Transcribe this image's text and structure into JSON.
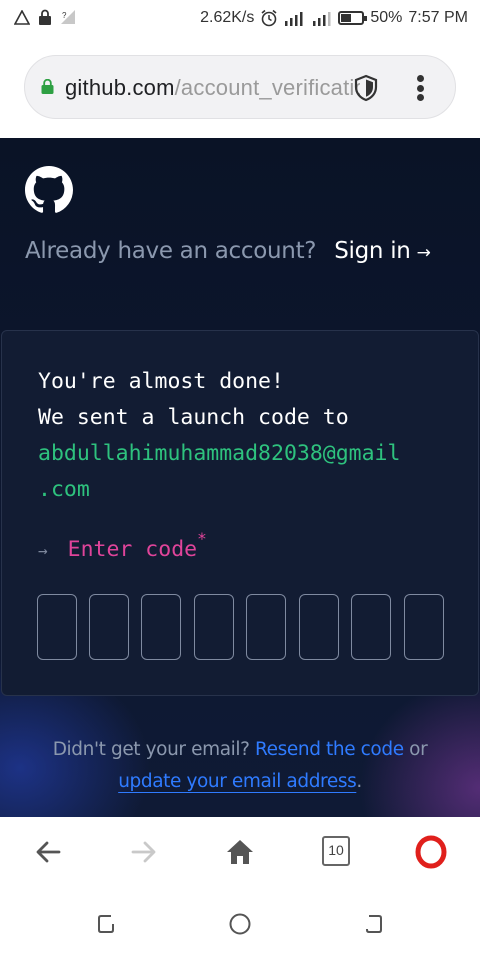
{
  "status_bar": {
    "net_speed": "2.62K/s",
    "battery_percent": "50%",
    "time": "7:57 PM"
  },
  "browser": {
    "url_host": "github.com",
    "url_path": "/account_verifications",
    "tab_count": "10",
    "colors": {
      "lock": "#2ea043",
      "opera": "#e0201c"
    }
  },
  "page": {
    "already_text": "Already have an account?",
    "signin_label": "Sign in",
    "signin_arrow": "→",
    "card": {
      "line1": "You're almost done!",
      "line2": "We sent a launch code to",
      "email_line1": "abdullahimuhammad82038@gmail",
      "email_line2": ".com",
      "enter_arrow": "→",
      "enter_label": "Enter code",
      "required_mark": "*",
      "code_digits": [
        "",
        "",
        "",
        "",
        "",
        "",
        "",
        ""
      ]
    },
    "footer": {
      "text1": "Didn't get your email?",
      "resend_link": "Resend the code",
      "text2": "or",
      "update_link": "update your email address",
      "text3": "."
    }
  }
}
